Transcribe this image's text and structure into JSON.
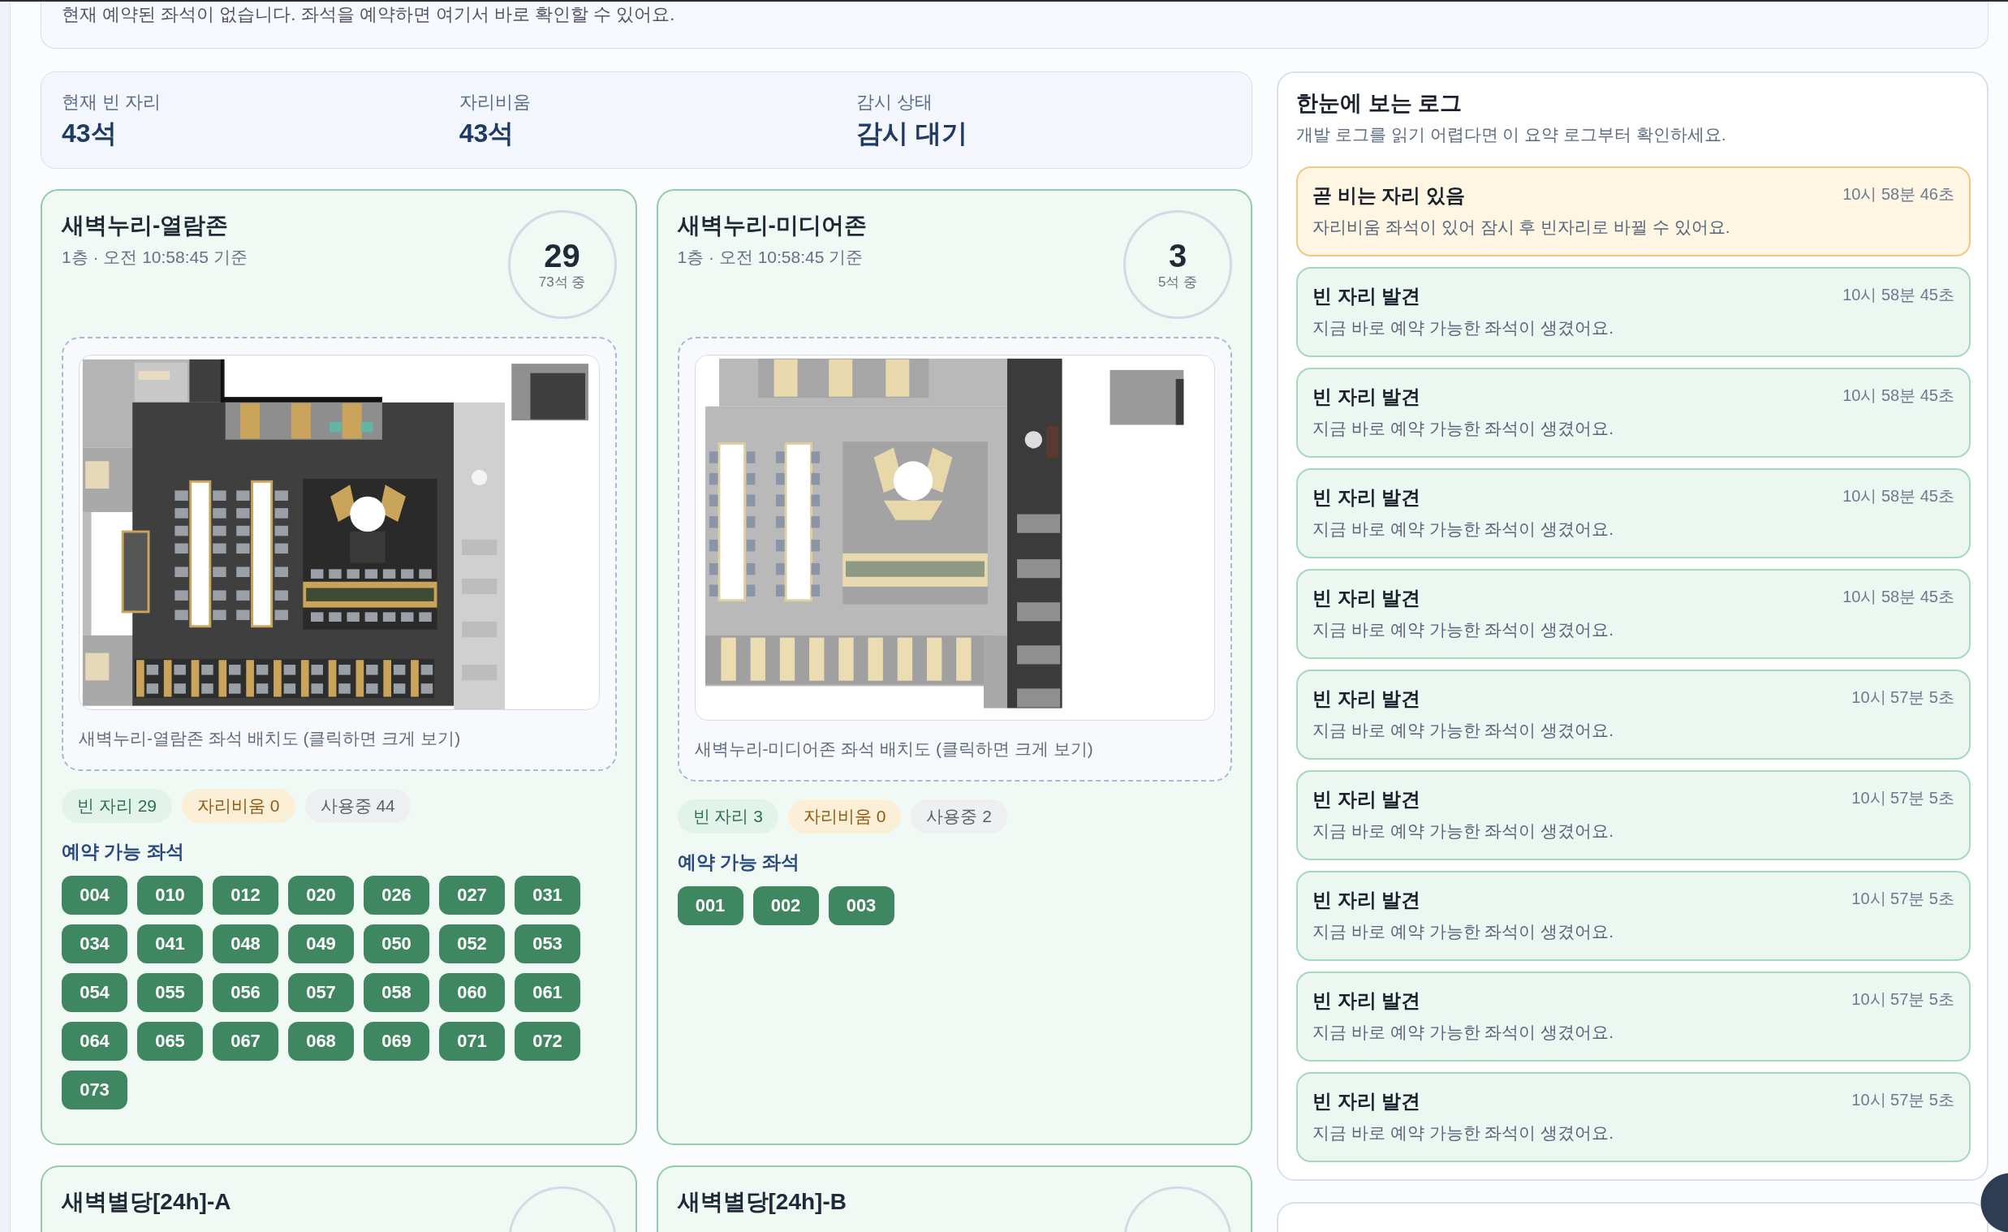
{
  "top_notice": {
    "text": "현재 예약된 좌석이 없습니다. 좌석을 예약하면 여기서 바로 확인할 수 있어요."
  },
  "summary": [
    {
      "label": "현재 빈 자리",
      "value": "43석"
    },
    {
      "label": "자리비움",
      "value": "43석"
    },
    {
      "label": "감시 상태",
      "value": "감시 대기"
    }
  ],
  "zones": [
    {
      "name": "새벽누리-열람존",
      "subtitle": "1층 · 오전 10:58:45 기준",
      "available": "29",
      "total": "73석 중",
      "floor_plan": {
        "caption": "새벽누리-열람존 좌석 배치도 (클릭하면 크게 보기)"
      },
      "badges": [
        {
          "kind": "free",
          "label": "빈 자리 29"
        },
        {
          "kind": "away",
          "label": "자리비움 0"
        },
        {
          "kind": "in_use",
          "label": "사용중 44"
        }
      ],
      "seats_heading": "예약 가능 좌석",
      "seats": [
        "004",
        "010",
        "012",
        "020",
        "026",
        "027",
        "031",
        "034",
        "041",
        "048",
        "049",
        "050",
        "052",
        "053",
        "054",
        "055",
        "056",
        "057",
        "058",
        "060",
        "061",
        "064",
        "065",
        "067",
        "068",
        "069",
        "071",
        "072",
        "073"
      ]
    },
    {
      "name": "새벽누리-미디어존",
      "subtitle": "1층 · 오전 10:58:45 기준",
      "available": "3",
      "total": "5석 중",
      "floor_plan": {
        "caption": "새벽누리-미디어존 좌석 배치도 (클릭하면 크게 보기)"
      },
      "badges": [
        {
          "kind": "free",
          "label": "빈 자리 3"
        },
        {
          "kind": "away",
          "label": "자리비움 0"
        },
        {
          "kind": "in_use",
          "label": "사용중 2"
        }
      ],
      "seats_heading": "예약 가능 좌석",
      "seats": [
        "001",
        "002",
        "003"
      ]
    },
    {
      "name": "새벽별당[24h]-A"
    },
    {
      "name": "새벽별당[24h]-B"
    }
  ],
  "summary_log": {
    "title": "한눈에 보는 로그",
    "subtitle": "개발 로그를 읽기 어렵다면 이 요약 로그부터 확인하세요.",
    "entries": [
      {
        "kind": "warning",
        "title": "곧 비는 자리 있음",
        "message": "자리비움 좌석이 있어 잠시 후 빈자리로 바뀔 수 있어요.",
        "time": "10시 58분 46초"
      },
      {
        "kind": "success",
        "title": "빈 자리 발견",
        "message": "지금 바로 예약 가능한 좌석이 생겼어요.",
        "time": "10시 58분 45초"
      },
      {
        "kind": "success",
        "title": "빈 자리 발견",
        "message": "지금 바로 예약 가능한 좌석이 생겼어요.",
        "time": "10시 58분 45초"
      },
      {
        "kind": "success",
        "title": "빈 자리 발견",
        "message": "지금 바로 예약 가능한 좌석이 생겼어요.",
        "time": "10시 58분 45초"
      },
      {
        "kind": "success",
        "title": "빈 자리 발견",
        "message": "지금 바로 예약 가능한 좌석이 생겼어요.",
        "time": "10시 58분 45초"
      },
      {
        "kind": "success",
        "title": "빈 자리 발견",
        "message": "지금 바로 예약 가능한 좌석이 생겼어요.",
        "time": "10시 57분 5초"
      },
      {
        "kind": "success",
        "title": "빈 자리 발견",
        "message": "지금 바로 예약 가능한 좌석이 생겼어요.",
        "time": "10시 57분 5초"
      },
      {
        "kind": "success",
        "title": "빈 자리 발견",
        "message": "지금 바로 예약 가능한 좌석이 생겼어요.",
        "time": "10시 57분 5초"
      },
      {
        "kind": "success",
        "title": "빈 자리 발견",
        "message": "지금 바로 예약 가능한 좌석이 생겼어요.",
        "time": "10시 57분 5초"
      },
      {
        "kind": "success",
        "title": "빈 자리 발견",
        "message": "지금 바로 예약 가능한 좌석이 생겼어요.",
        "time": "10시 57분 5초"
      }
    ]
  }
}
